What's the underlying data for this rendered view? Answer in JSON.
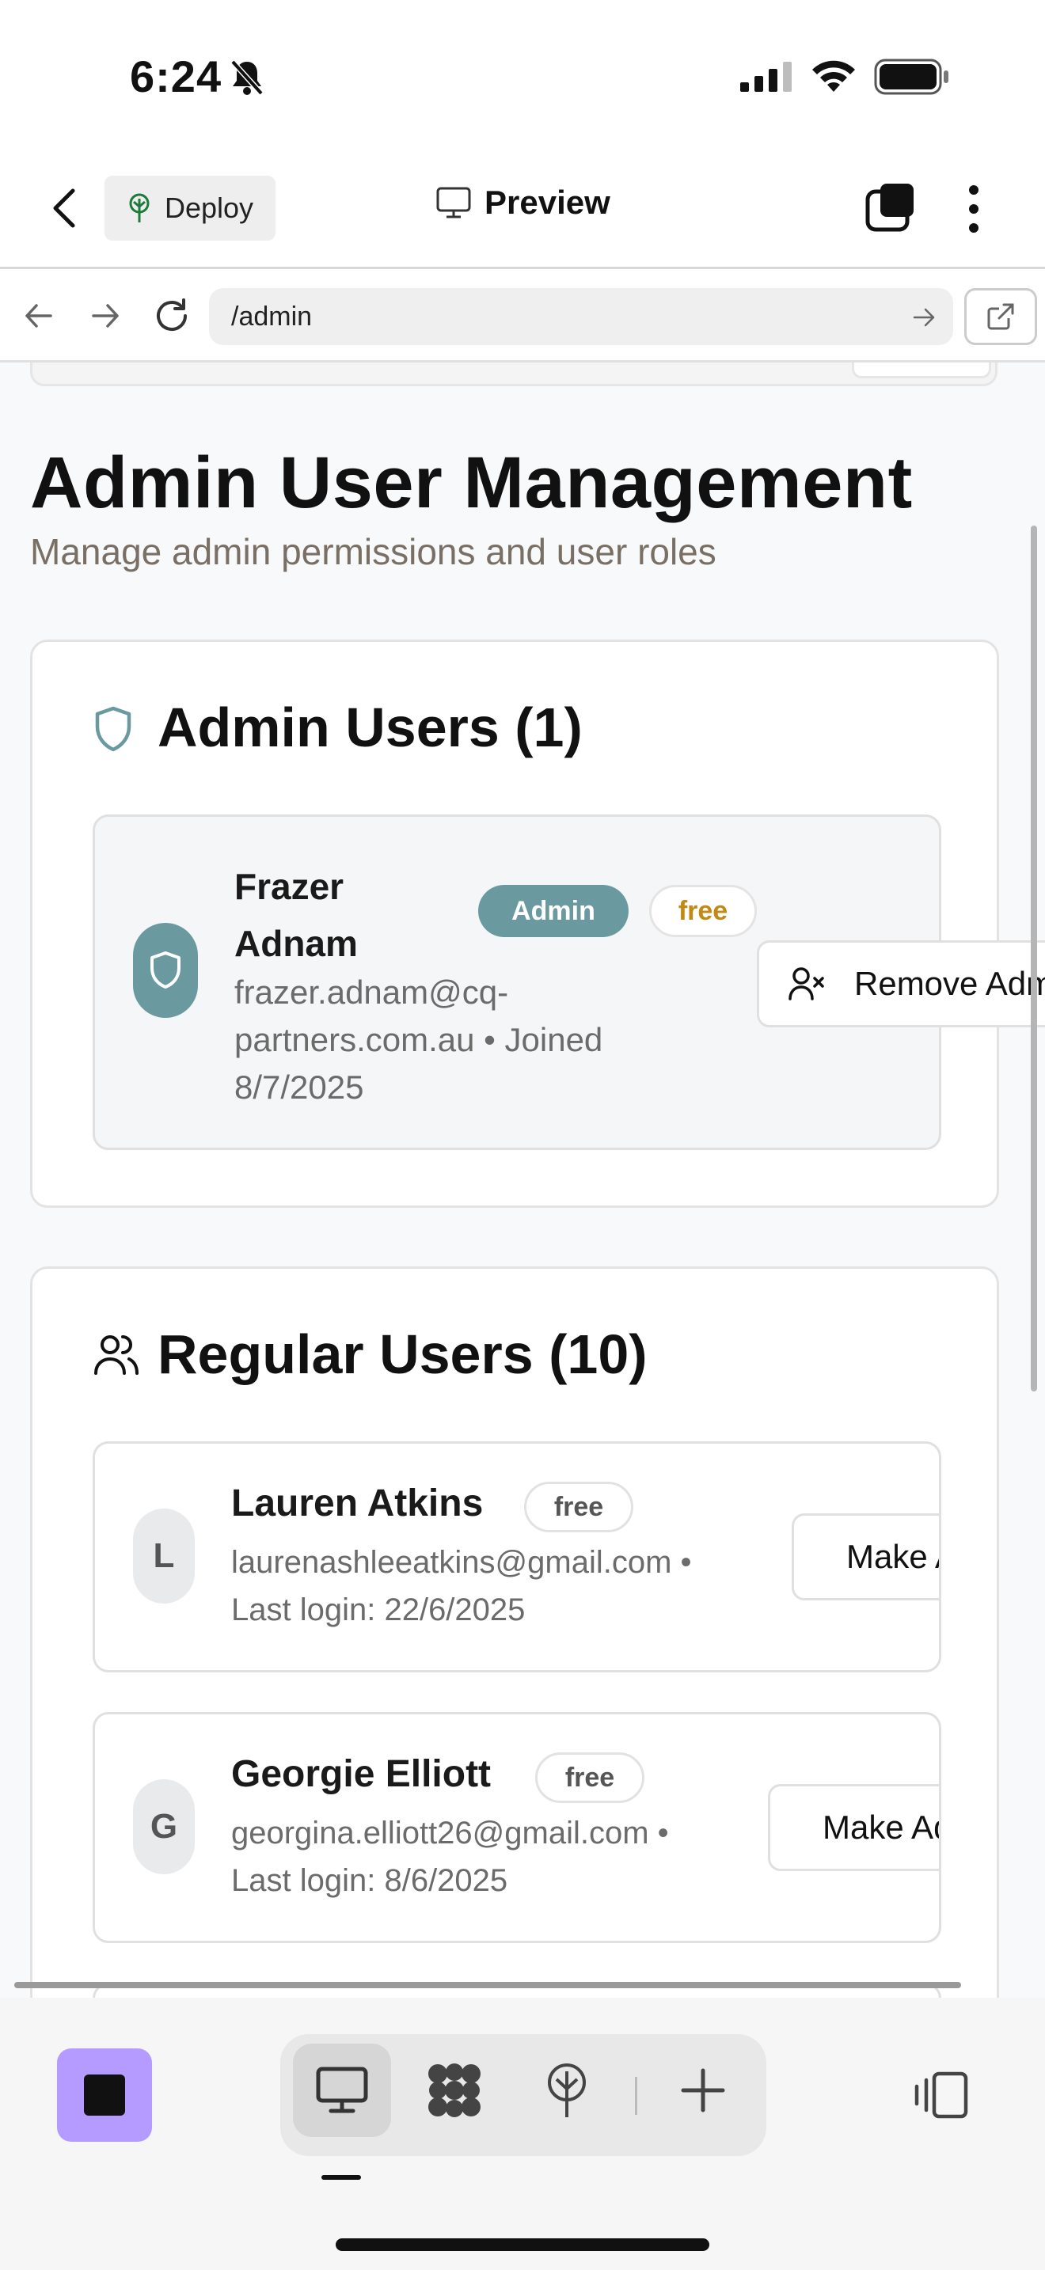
{
  "status_bar": {
    "time": "6:24",
    "icons": [
      "bell-slash-icon",
      "cellular-signal-icon",
      "wifi-icon",
      "battery-icon"
    ]
  },
  "header": {
    "deploy_label": "Deploy",
    "title": "Preview",
    "icons": [
      "chevron-left-icon",
      "deploy-tree-icon",
      "monitor-icon",
      "tabs-icon",
      "more-vertical-icon"
    ]
  },
  "url_bar": {
    "value": "/admin",
    "icons": [
      "arrow-left-icon",
      "arrow-right-icon",
      "reload-icon",
      "go-arrow-icon",
      "external-link-icon"
    ]
  },
  "page": {
    "title": "Admin User Management",
    "subtitle": "Manage admin permissions and user roles"
  },
  "admin_section": {
    "title": "Admin Users (1)",
    "icon": "shield-icon",
    "users": [
      {
        "name": "Frazer Adnam",
        "role_badge": "Admin",
        "plan_badge": "free",
        "email_line": "frazer.adnam@cq-partners.com.au • Joined 8/7/2025",
        "action_label": "Remove Admin"
      }
    ]
  },
  "regular_section": {
    "title": "Regular Users (10)",
    "icon": "users-icon",
    "users": [
      {
        "initial": "L",
        "name": "Lauren Atkins",
        "plan_badge": "free",
        "email_line": "laurenashleeatkins@gmail.com •",
        "last_login": "Last login: 22/6/2025",
        "action_label": "Make Admin"
      },
      {
        "initial": "G",
        "name": "Georgie Elliott",
        "plan_badge": "free",
        "email_line": "georgina.elliott26@gmail.com •",
        "last_login": "Last login: 8/6/2025",
        "action_label": "Make Admin"
      }
    ]
  },
  "toolbar": {
    "icons": [
      "stop-icon",
      "desktop-icon",
      "grid-blob-icon",
      "deploy-tree-icon",
      "plus-icon",
      "panel-toggle-icon"
    ],
    "accent_color": "#b59bff"
  },
  "colors": {
    "admin_teal": "#6a9aa0",
    "free_gold": "#c08a14"
  }
}
